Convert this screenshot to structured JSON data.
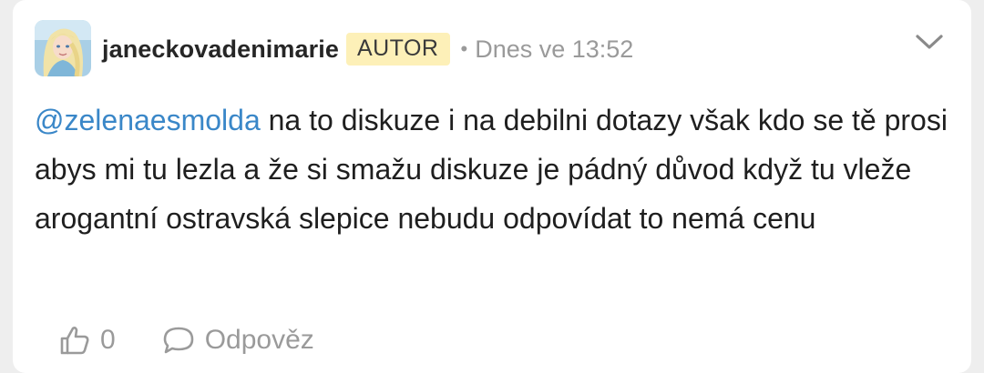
{
  "comment": {
    "username": "janeckovadenimarie",
    "badge": "AUTOR",
    "separator": "•",
    "timestamp": "Dnes ve 13:52",
    "mention": "@zelenaesmolda",
    "text": " na to diskuze i na debilni dotazy však kdo se tě prosi abys mi tu lezla a že si smažu diskuze je pádný důvod když tu vleže arogantní ostravská slepice nebudu odpovídat to nemá cenu",
    "like_count": "0",
    "reply_label": "Odpověz"
  },
  "icons": {
    "menu": "chevron-down-icon",
    "like": "thumbs-up-icon",
    "reply": "speech-bubble-icon",
    "avatar": "avatar-image"
  },
  "colors": {
    "mention": "#3a87c8",
    "badge_bg": "#fdf0b8",
    "muted": "#9a9a9a",
    "text": "#1f1f1f",
    "background": "#eeeeee"
  }
}
